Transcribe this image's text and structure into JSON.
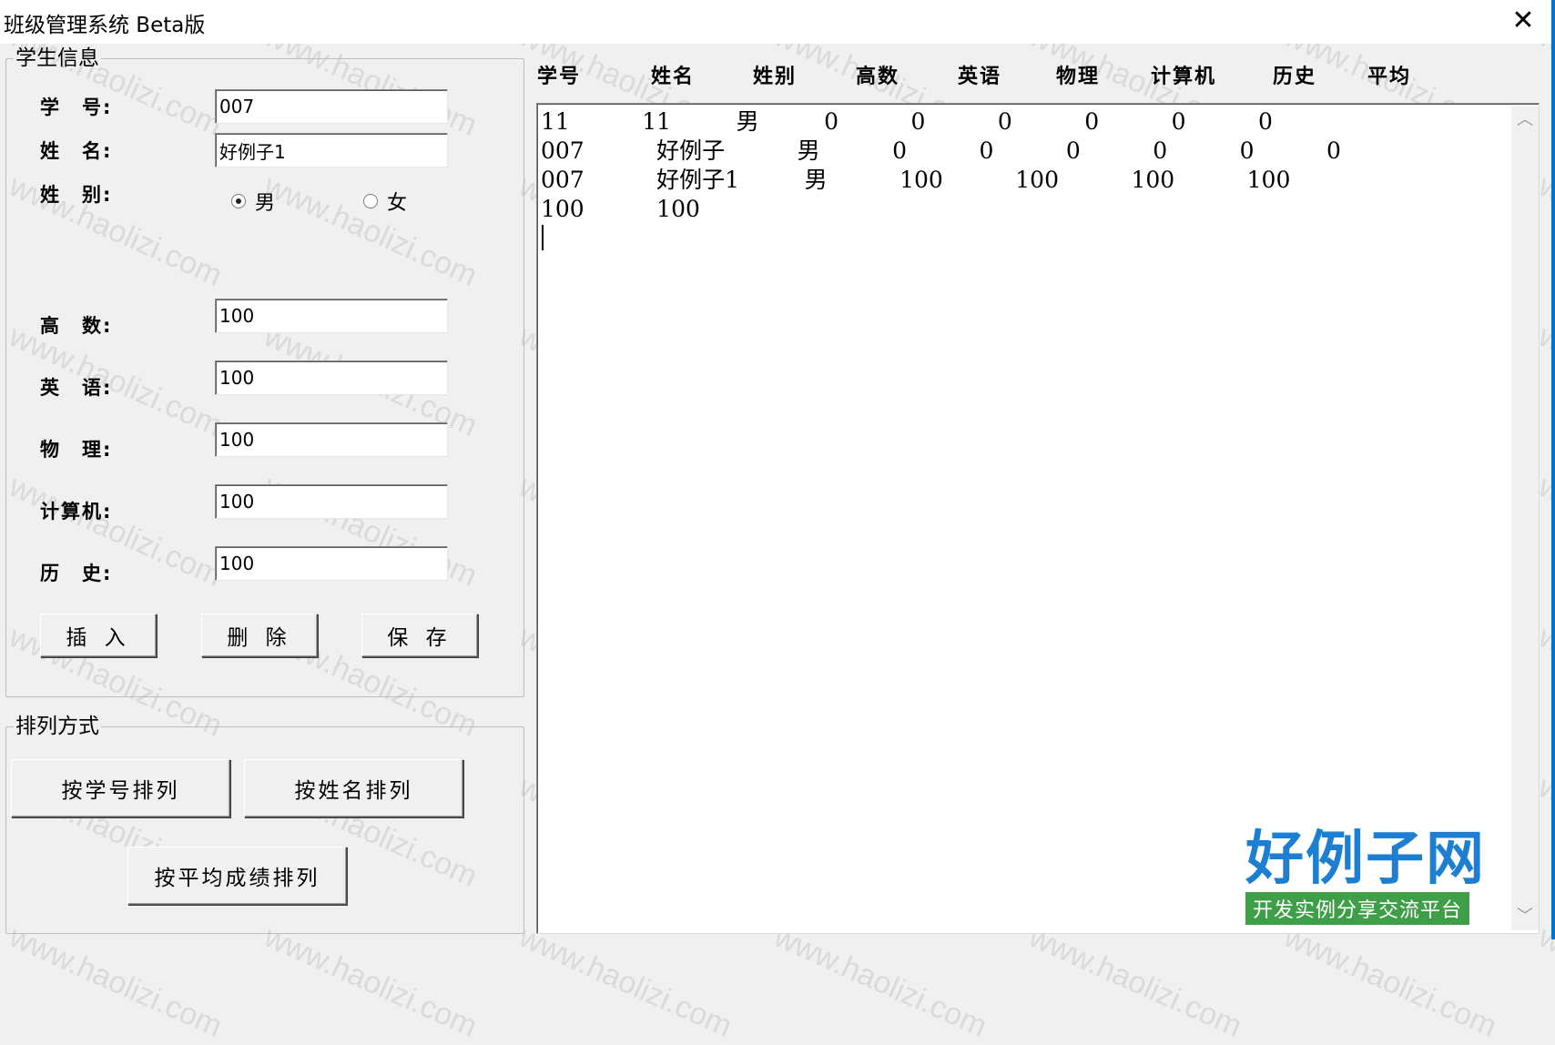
{
  "window": {
    "title": "班级管理系统  Beta版",
    "close_label": "✕"
  },
  "student_group": {
    "legend": "学生信息",
    "fields": {
      "id": {
        "label": "学　号:",
        "value": "007"
      },
      "name": {
        "label": "姓　名:",
        "value": "好例子1"
      },
      "gender": {
        "label": "姓　别:",
        "options": [
          "男",
          "女"
        ],
        "selected": "男"
      },
      "math": {
        "label": "高　数:",
        "value": "100"
      },
      "english": {
        "label": "英　语:",
        "value": "100"
      },
      "physics": {
        "label": "物　理:",
        "value": "100"
      },
      "computer": {
        "label": "计算机:",
        "value": "100"
      },
      "history": {
        "label": "历　史:",
        "value": "100"
      }
    },
    "buttons": {
      "insert": "插 入",
      "delete": "删 除",
      "save": "保 存"
    }
  },
  "sort_group": {
    "legend": "排列方式",
    "buttons": {
      "by_id": "按学号排列",
      "by_name": "按姓名排列",
      "by_avg": "按平均成绩排列"
    }
  },
  "records": {
    "headers": [
      "学号",
      "姓名",
      "姓别",
      "高数",
      "英语",
      "物理",
      "计算机",
      "历史",
      "平均"
    ],
    "lines": [
      "11          11         男         0          0          0          0          0          0",
      "007          好例子          男          0          0          0          0          0          0",
      "007          好例子1         男          100          100          100          100",
      "100          100"
    ]
  },
  "watermark": {
    "text": "www.haolizi.com"
  },
  "logo": {
    "main": "好例子网",
    "sub": "开发实例分享交流平台"
  }
}
